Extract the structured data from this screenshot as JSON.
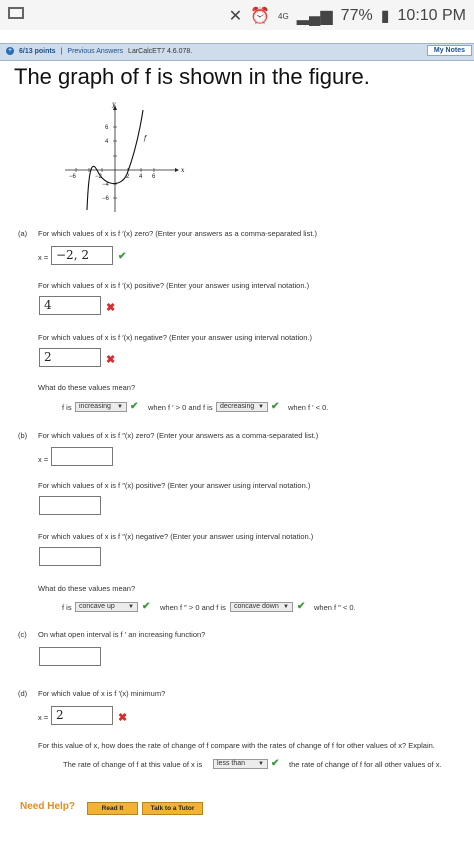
{
  "statusbar": {
    "battery": "77%",
    "time": "10:10 PM",
    "network": "4G"
  },
  "toolbar": {
    "points": "6/13 points",
    "separator": "|",
    "previous_answers": "Previous Answers",
    "problem_id": "LarCalcET7 4.6.078.",
    "my_notes": "My Notes"
  },
  "title": "The graph of f is shown in the figure.",
  "graph": {
    "y_axis_label": "y",
    "x_axis_label": "x",
    "curve_label": "f",
    "x_ticks": [
      "−6",
      "−2",
      "2",
      "4",
      "6"
    ],
    "y_ticks": [
      "6",
      "4",
      "−4",
      "−6"
    ]
  },
  "part_a": {
    "label": "(a)",
    "q1": "For which values of x is f ′(x) zero? (Enter your answers as a comma-separated list.)",
    "q1_prefix": "x =",
    "q1_answer": "−2, 2",
    "q2": "For which values of x is f ′(x) positive? (Enter your answer using interval notation.)",
    "q2_answer": "4",
    "q3": "For which values of x is f ′(x) negative? (Enter your answer using interval notation.)",
    "q3_answer": "2",
    "q4": "What do these values mean?",
    "f_is": "f is",
    "select1": "increasing",
    "when_pos": "when f ′ > 0 and f is",
    "select2": "decreasing",
    "when_neg": "when f ′ < 0."
  },
  "part_b": {
    "label": "(b)",
    "q1": "For which values of x is f ″(x) zero? (Enter your answers as a comma-separated list.)",
    "q1_prefix": "x =",
    "q2": "For which values of x is f ″(x) positive? (Enter your answer using interval notation.)",
    "q3": "For which values of x is f ″(x) negative? (Enter your answer using interval notation.)",
    "q4": "What do these values mean?",
    "f_is": "f is",
    "select1": "concave up",
    "when_pos": "when f ″ > 0 and f is",
    "select2": "concave down",
    "when_neg": "when f ″ < 0."
  },
  "part_c": {
    "label": "(c)",
    "q1": "On what open interval is f ′ an increasing function?"
  },
  "part_d": {
    "label": "(d)",
    "q1": "For which value of x is f ′(x) minimum?",
    "q1_prefix": "x =",
    "q1_answer": "2",
    "q2": "For this value of x, how does the rate of change of f compare with the rates of change of f for other values of x? Explain.",
    "sent_prefix": "The rate of change of f at this value of x is",
    "select1": "less than",
    "sent_suffix": "the rate of change of f for all other values of x."
  },
  "help": {
    "need_help": "Need Help?",
    "read_it": "Read It",
    "talk_tutor": "Talk to a Tutor"
  },
  "colors": {
    "toolbar_bg": "#cfdcec",
    "correct": "#3a9a3a",
    "incorrect": "#d62e2e",
    "help_orange": "#e8891d",
    "button_bg": "#f4b233"
  }
}
